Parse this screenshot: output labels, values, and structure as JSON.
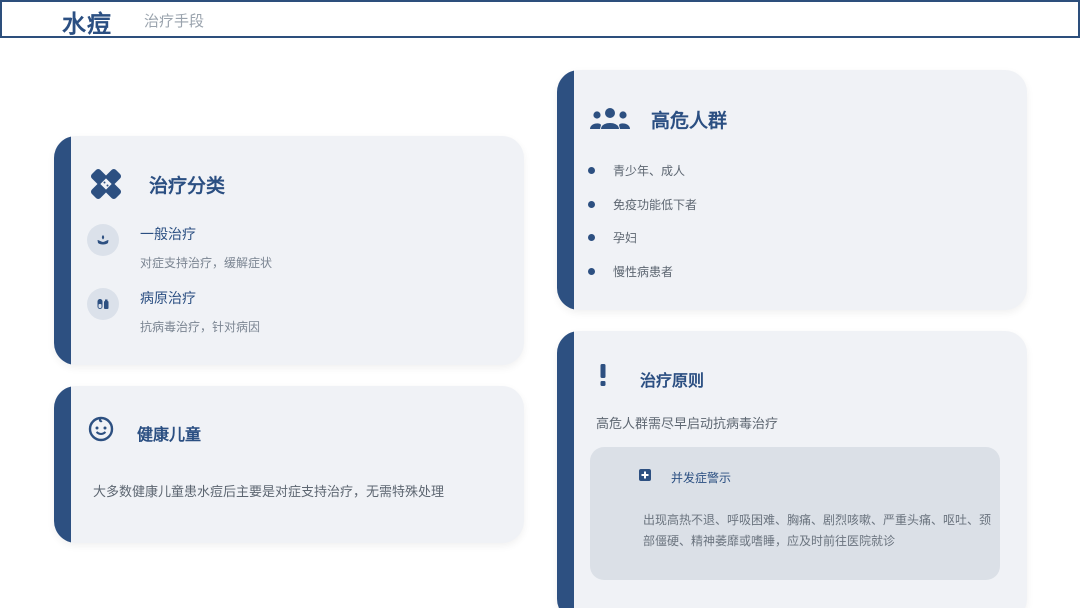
{
  "header": {
    "title": "水痘",
    "subtitle": "治疗手段"
  },
  "treatment": {
    "title": "治疗分类",
    "icon": "bandage-icon",
    "items": [
      {
        "name": "一般治疗",
        "desc": "对症支持治疗，缓解症状",
        "icon": "hand-care-icon"
      },
      {
        "name": "病原治疗",
        "desc": "抗病毒治疗，针对病因",
        "icon": "pills-icon"
      }
    ]
  },
  "children": {
    "title": "健康儿童",
    "icon": "baby-face-icon",
    "text": "大多数健康儿童患水痘后主要是对症支持治疗，无需特殊处理"
  },
  "risk": {
    "title": "高危人群",
    "icon": "users-group-icon",
    "items": [
      "青少年、成人",
      "免疫功能低下者",
      "孕妇",
      "慢性病患者"
    ]
  },
  "principle": {
    "title": "治疗原则",
    "icon": "exclamation-icon",
    "text": "高危人群需尽早启动抗病毒治疗",
    "warning": {
      "title": "并发症警示",
      "icon": "medical-plus-icon",
      "text": "出现高热不退、呼吸困难、胸痛、剧烈咳嗽、严重头痛、呕吐、颈部僵硬、精神萎靡或嗜睡，应及时前往医院就诊"
    }
  },
  "colors": {
    "accent": "#2d5081",
    "card_bg": "#f0f2f6",
    "warn_bg": "#dbe0e7"
  }
}
